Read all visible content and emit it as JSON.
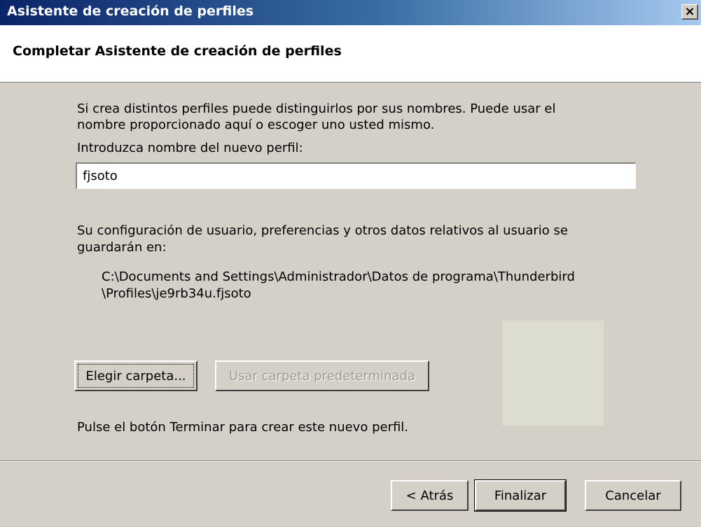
{
  "window": {
    "title": "Asistente de creación de perfiles",
    "close_label": "×"
  },
  "header": {
    "title": "Completar Asistente de creación de perfiles"
  },
  "body": {
    "intro_line1": "Si crea distintos perfiles puede distinguirlos por sus nombres. Puede usar el",
    "intro_line2": "nombre proporcionado aquí o escoger uno usted mismo.",
    "name_label": "Introduzca nombre del nuevo perfil:",
    "name_value": "fjsoto",
    "storage_line1": "Su configuración de usuario, preferencias y otros datos relativos al usuario se",
    "storage_line2": "guardarán en:",
    "path_line1": "C:\\Documents and Settings\\Administrador\\Datos de programa\\Thunderbird",
    "path_line2": "\\Profiles\\je9rb34u.fjsoto",
    "choose_folder_label": "Elegir carpeta...",
    "default_folder_label": "Usar carpeta predeterminada",
    "finish_hint": "Pulse el botón Terminar para crear este nuevo perfil."
  },
  "footer": {
    "back_label": "< Atrás",
    "finish_label": "Finalizar",
    "cancel_label": "Cancelar"
  }
}
